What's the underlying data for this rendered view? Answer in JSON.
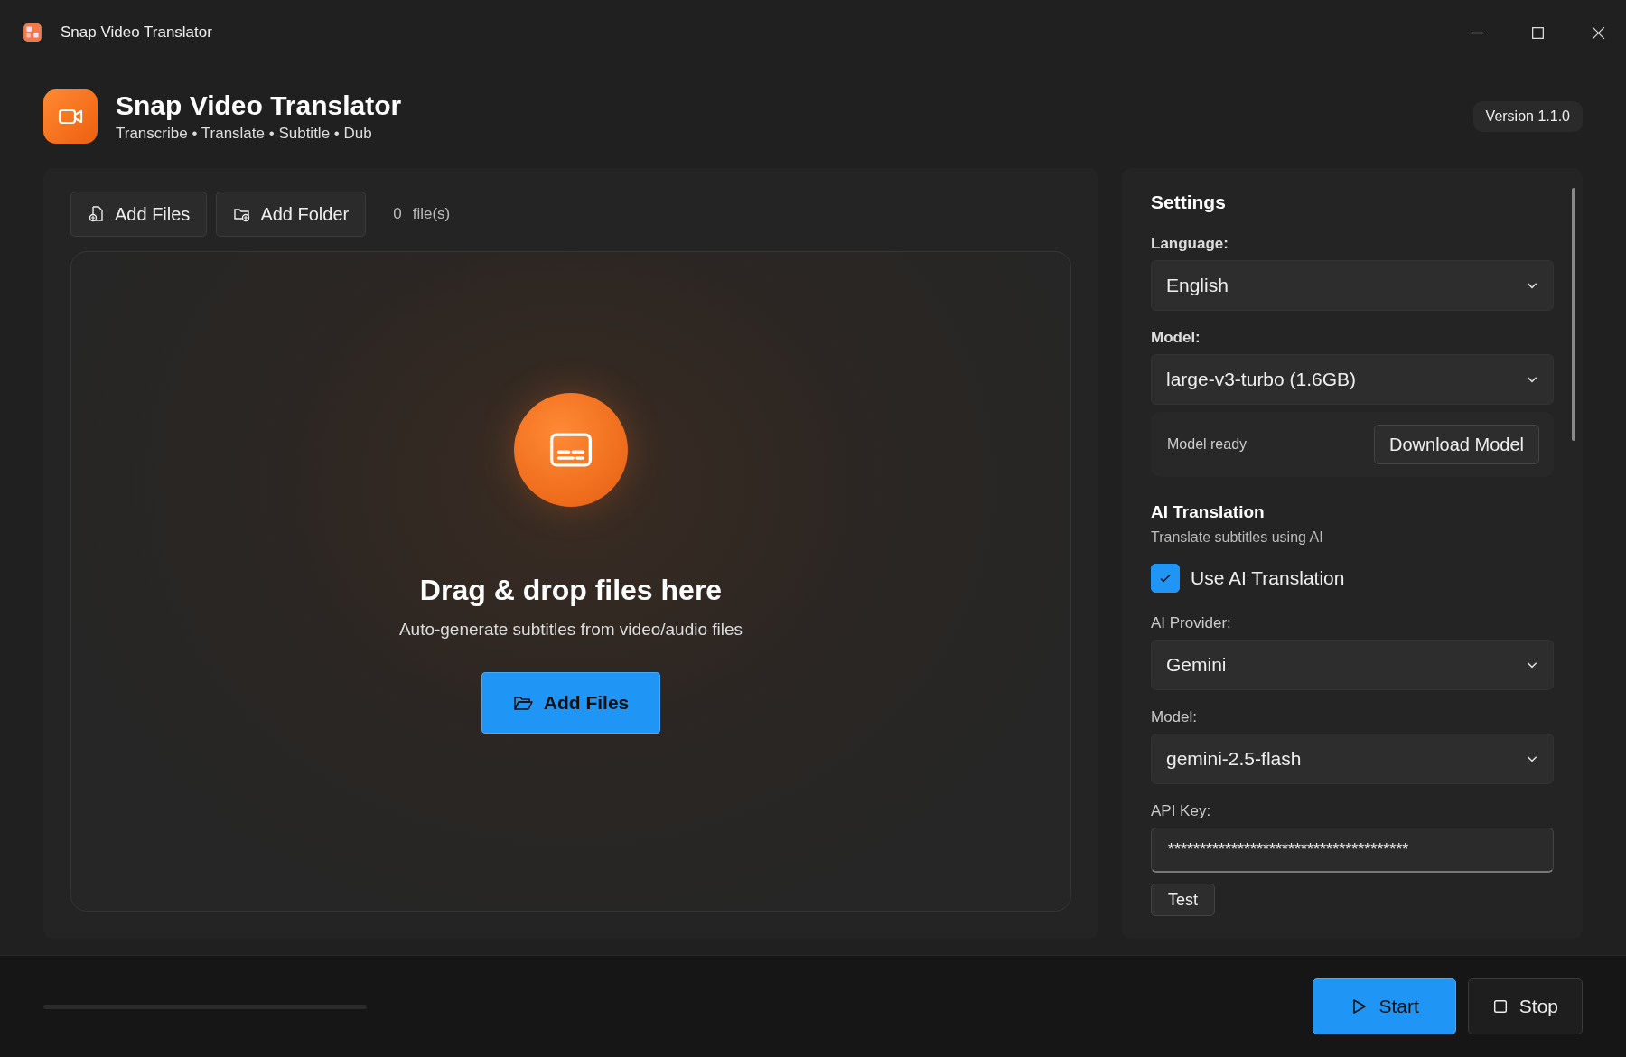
{
  "window": {
    "title": "Snap Video Translator"
  },
  "header": {
    "title": "Snap Video Translator",
    "subtitle": "Transcribe • Translate • Subtitle • Dub",
    "version": "Version 1.1.0"
  },
  "toolbar": {
    "buttons": [
      {
        "label": "Add Files",
        "kind": "file"
      },
      {
        "label": "Add Folder",
        "kind": "folder"
      }
    ],
    "count": "0",
    "count_unit": "file(s)"
  },
  "drop_zone": {
    "title": "Drag & drop files here",
    "subtitle": "Auto-generate subtitles from video/audio files",
    "button": "Add Files"
  },
  "settings": {
    "title": "Settings",
    "language": {
      "label": "Language:",
      "value": "English"
    },
    "model": {
      "label": "Model:",
      "value": "large-v3-turbo (1.6GB)"
    },
    "model_status": {
      "text": "Model ready",
      "button": "Download Model"
    },
    "ai": {
      "title": "AI Translation",
      "description": "Translate subtitles using AI",
      "use_ai": {
        "label": "Use AI Translation",
        "checked": true
      },
      "provider": {
        "label": "AI Provider:",
        "value": "Gemini"
      },
      "model": {
        "label": "Model:",
        "value": "gemini-2.5-flash"
      },
      "api_key": {
        "label": "API Key:",
        "value": "**************************************"
      },
      "test_button": "Test"
    }
  },
  "footer": {
    "progress": {
      "level": 0
    },
    "buttons": [
      {
        "label": "Start",
        "kind": "primary"
      },
      {
        "label": "Stop",
        "kind": "secondary"
      }
    ]
  }
}
